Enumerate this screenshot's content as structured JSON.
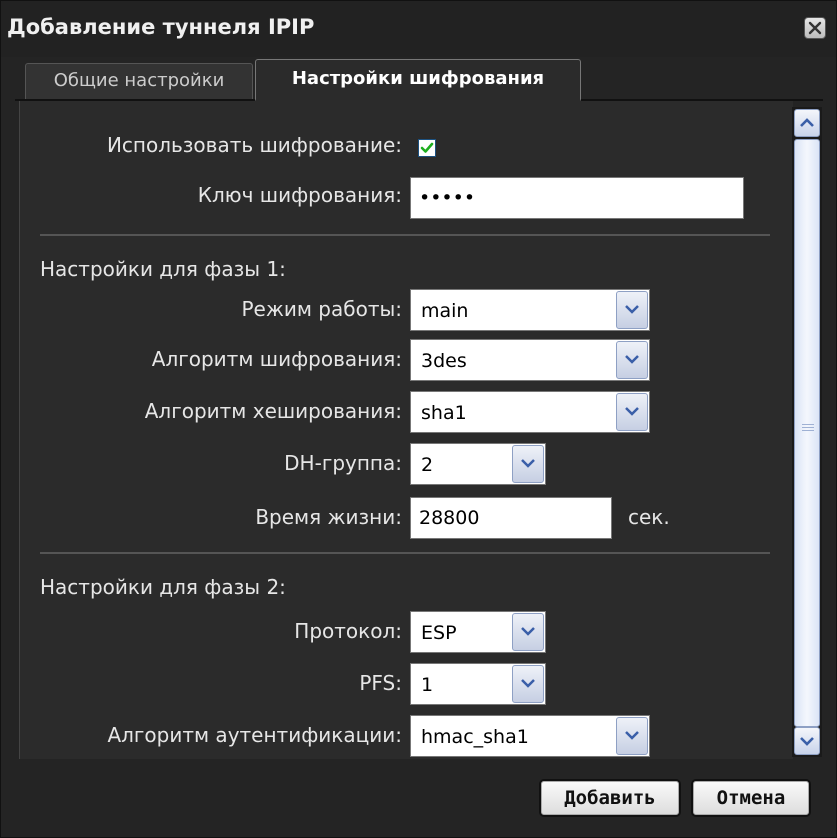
{
  "dialog": {
    "title": "Добавление туннеля IPIP"
  },
  "tabs": [
    {
      "label": "Общие настройки",
      "active": false
    },
    {
      "label": "Настройки шифрования",
      "active": true
    }
  ],
  "encryption": {
    "use_label": "Использовать шифрование:",
    "use_checked": true,
    "key_label": "Ключ шифрования:",
    "key_value": "•••••"
  },
  "phase1": {
    "title": "Настройки для фазы 1:",
    "mode_label": "Режим работы:",
    "mode_value": "main",
    "enc_alg_label": "Алгоритм шифрования:",
    "enc_alg_value": "3des",
    "hash_alg_label": "Алгоритм хеширования:",
    "hash_alg_value": "sha1",
    "dh_label": "DH-группа:",
    "dh_value": "2",
    "lifetime_label": "Время жизни:",
    "lifetime_value": "28800",
    "lifetime_unit": "сек."
  },
  "phase2": {
    "title": "Настройки для фазы 2:",
    "protocol_label": "Протокол:",
    "protocol_value": "ESP",
    "pfs_label": "PFS:",
    "pfs_value": "1",
    "auth_alg_label": "Алгоритм аутентификации:",
    "auth_alg_value": "hmac_sha1"
  },
  "footer": {
    "add_label": "Добавить",
    "cancel_label": "Отмена"
  },
  "icons": {
    "close": "close-icon",
    "dropdown": "chevron-down-icon",
    "check": "check-icon",
    "scroll_up": "chevron-up-icon",
    "scroll_down": "chevron-down-icon"
  },
  "colors": {
    "background": "#242424",
    "panel": "#2b2b2b",
    "check": "#1fae1f",
    "accent": "#8ea0c4"
  }
}
